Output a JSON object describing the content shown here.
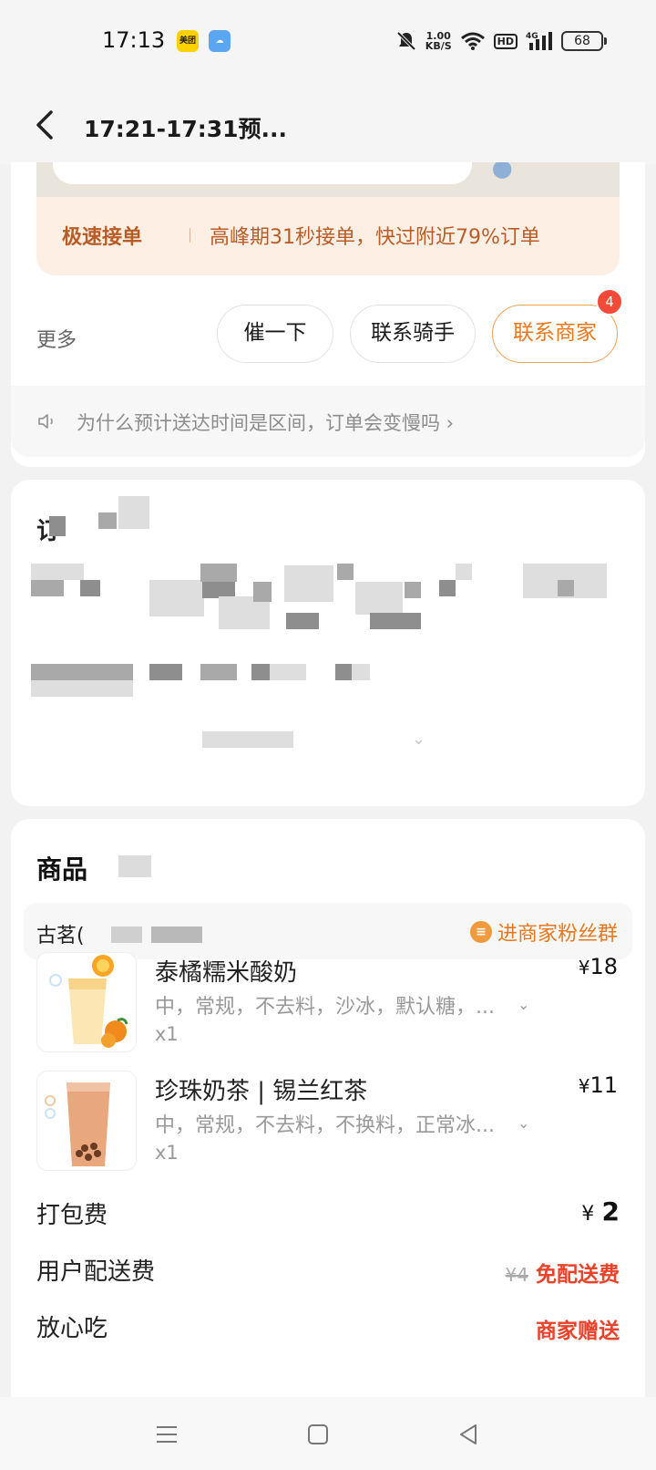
{
  "status_bar": {
    "time": "17:13",
    "app1": "美团",
    "speed_top": "1.00",
    "speed_bottom": "KB/S",
    "hd": "HD",
    "network": "4G",
    "battery": "68"
  },
  "header": {
    "title": "17:21-17:31预..."
  },
  "delivery": {
    "promo_key": "极速接单",
    "promo_text": "高峰期31秒接单，快过附近79%订单",
    "more_label": "更多",
    "buttons": [
      "催一下",
      "联系骑手",
      "联系商家"
    ],
    "merchant_badge": "4",
    "hint": "为什么预计送达时间是区间，订单会变慢吗"
  },
  "order_info": {
    "title": "订"
  },
  "goods": {
    "title": "商品",
    "shop_name": "古茗(",
    "fan_group": "进商家粉丝群",
    "items": [
      {
        "name": "泰橘糯米酸奶",
        "spec": "中，常规，不去料，沙冰，默认糖，...",
        "qty": "x1",
        "currency": "¥",
        "price": "18"
      },
      {
        "name": "珍珠奶茶 | 锡兰红茶",
        "spec": "中，常规，不去料，不换料，正常冰...",
        "qty": "x1",
        "currency": "¥",
        "price": "11"
      }
    ],
    "fees": {
      "pack_label": "打包费",
      "pack_currency": "¥",
      "pack_value": "2",
      "delivery_label": "用户配送费",
      "delivery_original": "¥4",
      "delivery_value": "免配送费",
      "safe_label": "放心吃",
      "safe_value": "商家赠送"
    }
  },
  "colors": {
    "accent_orange": "#e8781f",
    "promo_brown": "#b85d27",
    "badge_red": "#f24b3a",
    "price_red": "#e8432b"
  }
}
